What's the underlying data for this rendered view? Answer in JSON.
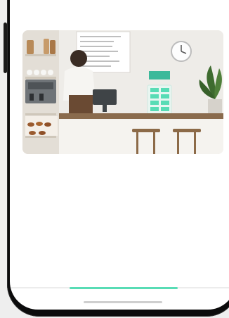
{
  "hero_image": {
    "description_icon": "cafe-counter-photo",
    "menu_board_lines": [
      "",
      "",
      "",
      "",
      "",
      "",
      "",
      ""
    ]
  },
  "carousel": {
    "active_index": 1,
    "count": 3,
    "accent_color": "#58dcb5"
  },
  "colors": {
    "device_frame": "#0b0b0c",
    "screen_bg": "#ffffff",
    "page_bg": "#eeeeee"
  }
}
